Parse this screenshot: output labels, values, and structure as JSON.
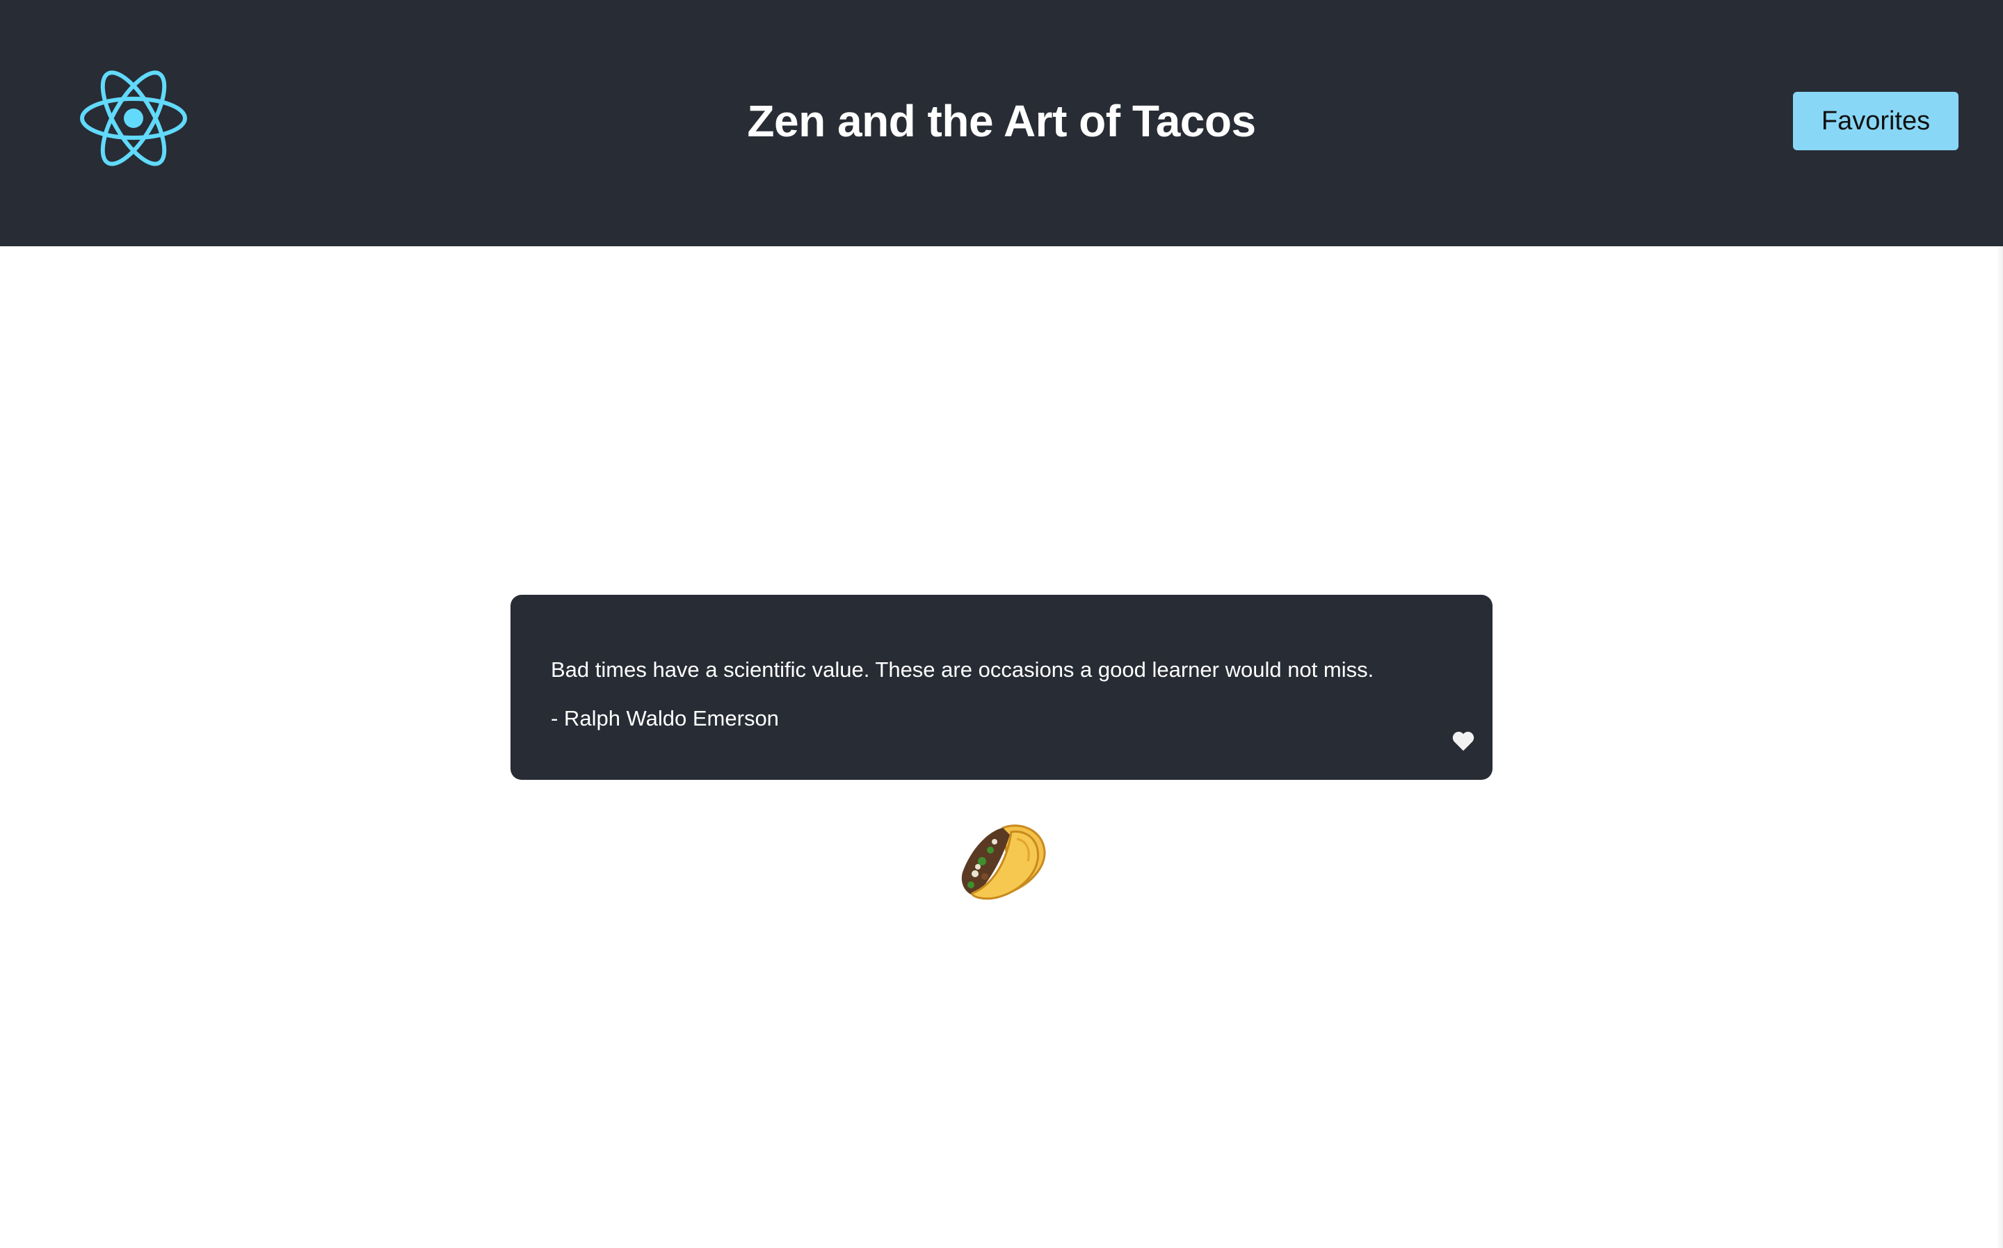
{
  "header": {
    "title": "Zen and the Art of Tacos",
    "favorites_label": "Favorites",
    "logo_icon": "react-atom-icon",
    "background_color": "#282c34",
    "accent_color": "#89d7f6"
  },
  "quote": {
    "text": "Bad times have a scientific value. These are occasions a good learner would not miss.",
    "author": "- Ralph Waldo Emerson",
    "favorite_icon": "heart-icon",
    "card_color": "#282c34"
  },
  "decoration": {
    "icon": "taco-icon"
  }
}
